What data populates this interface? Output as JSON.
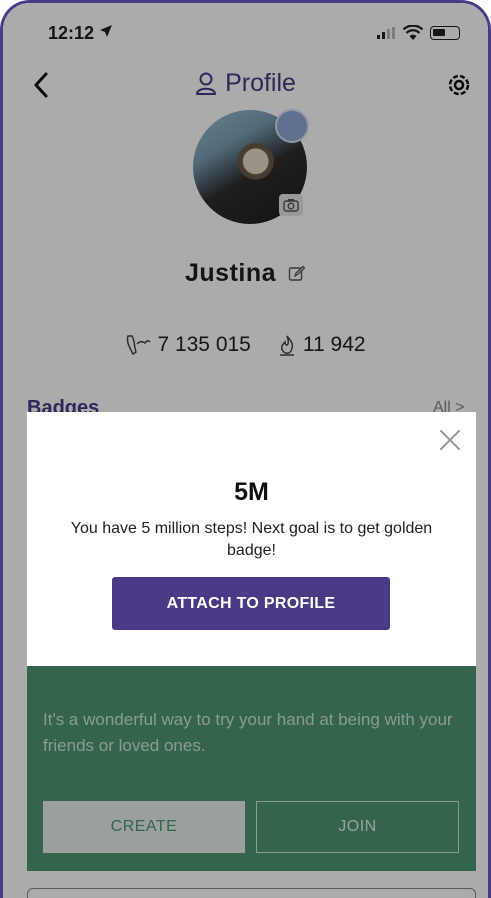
{
  "status_bar": {
    "time": "12:12"
  },
  "header": {
    "title": "Profile"
  },
  "profile": {
    "name": "Justina",
    "steps": "7 135 015",
    "calories": "11 942"
  },
  "badges": {
    "label": "Badges",
    "all_link": "All >"
  },
  "challenge_card": {
    "description": "It's a wonderful way to try your hand at being with your friends or loved ones.",
    "create_label": "CREATE",
    "join_label": "JOIN"
  },
  "modal": {
    "title": "5M",
    "message": "You have 5 million steps! Next goal is to get golden badge!",
    "attach_label": "ATTACH TO PROFILE"
  },
  "colors": {
    "brand_purple": "#4a3a86",
    "card_green": "#4e9670"
  }
}
